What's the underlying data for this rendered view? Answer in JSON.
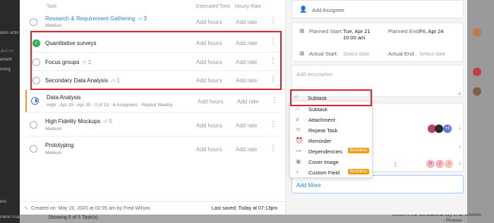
{
  "background": {
    "sidebar_texts": [
      "asks activ",
      "JECTS",
      "ement",
      "nning",
      "ess",
      "mend nTask"
    ],
    "bottom_text": "Showing 5 of 5 Task(s)",
    "quote_text": "Action is the foundational key to all success.",
    "quote_author": "- Picasso"
  },
  "task_list": {
    "headers": {
      "task": "Task",
      "estimated": "Estimated Time",
      "rate": "Hourly Rate"
    },
    "add_hours": "Add hours",
    "add_rate": "Add rate",
    "parent": {
      "title": "Research & Requirement Gathering",
      "subtasks": "3",
      "priority": "Medium"
    },
    "subtasks": [
      {
        "title": "Quantitative surveys",
        "done": true,
        "count": ""
      },
      {
        "title": "Focus groups",
        "done": false,
        "count": "2"
      },
      {
        "title": "Secondary Data Analysis",
        "done": false,
        "count": "1"
      }
    ],
    "tasks": [
      {
        "title": "Data Analysis",
        "meta": "High · Apr 25 - Apr 30 · 0 of 10 · 6 Assignees · Repeat Weekly",
        "count": ""
      },
      {
        "title": "High Fidelity Mockups",
        "meta": "Medium",
        "count": "5"
      },
      {
        "title": "Prototyping",
        "meta": "Medium",
        "count": ""
      }
    ]
  },
  "footer": {
    "created": "Created on: May 20, 2020 at 02:05 am by Fred Wilson.",
    "saved": "Last saved: Today at 07:13pm"
  },
  "details": {
    "add_assignee": "Add Assignee",
    "planned_start_label": "Planned Start:",
    "planned_start_value": "Tue, Apr 21",
    "planned_start_time": "10:00 am",
    "planned_end_label": "Planned End:",
    "planned_end_value": "Fri, Apr 24",
    "actual_start_label": "Actual Start:",
    "actual_end_label": "Actual End:",
    "select_date": "Select date",
    "description_placeholder": "Add description",
    "add_more": "Add More",
    "count_fragment": "1",
    "avatar_more": "+3",
    "avatars": [
      "H",
      "J",
      "J"
    ]
  },
  "add_menu": {
    "items": [
      {
        "label": "Subtask",
        "icon": "subtask-icon",
        "badge": ""
      },
      {
        "label": "Attachment",
        "icon": "paperclip-icon",
        "badge": ""
      },
      {
        "label": "Repeat Task",
        "icon": "repeat-icon",
        "badge": ""
      },
      {
        "label": "Reminder",
        "icon": "alarm-icon",
        "badge": ""
      },
      {
        "label": "Dependencies",
        "icon": "dependency-icon",
        "badge": "Business"
      },
      {
        "label": "Cover Image",
        "icon": "image-icon",
        "badge": ""
      },
      {
        "label": "Custom Field",
        "icon": "plus-icon",
        "badge": "Business"
      }
    ]
  },
  "colors": {
    "accent": "#2f7fd4",
    "highlight": "#e0202a",
    "badge": "#f39c12",
    "done": "#2fb05a"
  }
}
